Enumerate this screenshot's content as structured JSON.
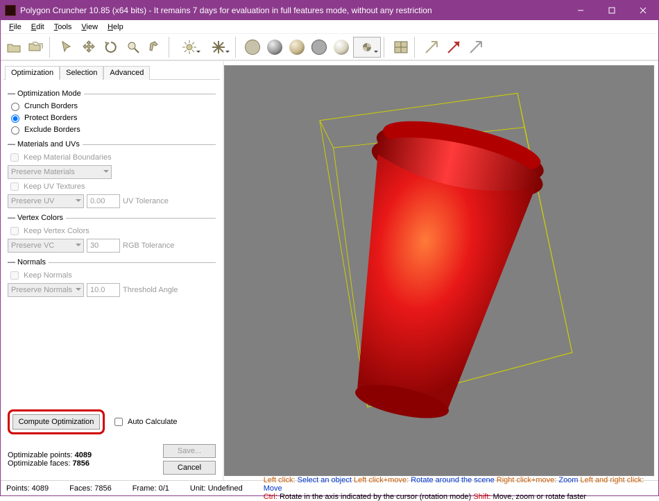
{
  "title": "Polygon Cruncher 10.85 (x64 bits) - It remains 7 days for evaluation in full features mode, without any restriction",
  "menus": {
    "file": "File",
    "edit": "Edit",
    "tools": "Tools",
    "view": "View",
    "help": "Help"
  },
  "tabs": {
    "optimization": "Optimization",
    "selection": "Selection",
    "advanced": "Advanced"
  },
  "group": {
    "mode": "Optimization Mode",
    "materials": "Materials and UVs",
    "vertex": "Vertex Colors",
    "normals": "Normals"
  },
  "mode": {
    "crunch": "Crunch Borders",
    "protect": "Protect Borders",
    "exclude": "Exclude Borders"
  },
  "mat": {
    "keep_boundaries": "Keep Material Boundaries",
    "preserve_materials": "Preserve Materials",
    "keep_uv": "Keep UV Textures",
    "preserve_uv": "Preserve UV",
    "uv_value": "0.00",
    "uv_tolerance": "UV Tolerance"
  },
  "vc": {
    "keep": "Keep Vertex Colors",
    "preserve": "Preserve VC",
    "value": "30",
    "rgb_tolerance": "RGB Tolerance"
  },
  "norm": {
    "keep": "Keep Normals",
    "preserve": "Preserve Normals",
    "value": "10.0",
    "threshold": "Threshold Angle"
  },
  "compute": "Compute Optimization",
  "auto_calculate": "Auto Calculate",
  "stats": {
    "points_label": "Optimizable points:",
    "points": "4089",
    "faces_label": "Optimizable faces:",
    "faces": "7856"
  },
  "save": "Save...",
  "cancel": "Cancel",
  "status": {
    "points": "Points: 4089",
    "faces": "Faces: 7856",
    "frame": "Frame: 0/1",
    "unit": "Unit: Undefined"
  },
  "hints": {
    "left_click": "Left click:",
    "select": "Select an object",
    "left_move": "Left click+move:",
    "rotate": "Rotate around the scene",
    "right_move": "Right click+move:",
    "zoom": "Zoom",
    "lr_click": "Left and right click:",
    "move": "Move",
    "ctrl": "Ctrl:",
    "ctrl_text": "Rotate in the axis indicated by the cursor (rotation mode)",
    "shift": "Shift:",
    "shift_text": "Move, zoom or rotate faster"
  }
}
